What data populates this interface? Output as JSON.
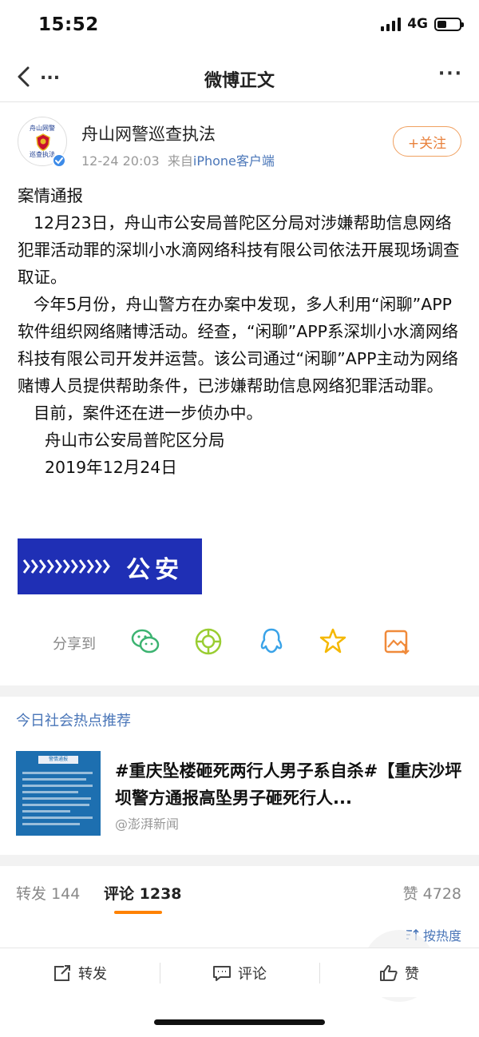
{
  "status_bar": {
    "time": "15:52",
    "network": "4G",
    "battery_level": 0.42
  },
  "nav": {
    "back_icon": "chevron-left-icon",
    "left_more": "...",
    "title": "微博正文",
    "right_more": "···"
  },
  "post": {
    "avatar": {
      "top_text": "舟山网警",
      "bottom_text": "巡查执法",
      "verified_color": "#3d8be8"
    },
    "author": "舟山网警巡查执法",
    "time": "12-24 20:03",
    "source_prefix": "来自",
    "source": "iPhone客户端",
    "follow_label": "+关注",
    "body": {
      "heading": "案情通报",
      "para1": "12月23日，舟山市公安局普陀区分局对涉嫌帮助信息网络犯罪活动罪的深圳小水滴网络科技有限公司依法开展现场调查取证。",
      "para2": "今年5月份，舟山警方在办案中发现，多人利用“闲聊”APP软件组织网络赌博活动。经查，“闲聊”APP系深圳小水滴网络科技有限公司开发并运营。该公司通过“闲聊”APP主动为网络赌博人员提供帮助条件，已涉嫌帮助信息网络犯罪活动罪。",
      "para3": "目前，案件还在进一步侦办中。",
      "signature_org": "舟山市公安局普陀区分局",
      "signature_date": "2019年12月24日"
    },
    "image_text": "公安",
    "image_color": "#1f2fb5"
  },
  "share": {
    "label": "分享到",
    "targets": [
      "wechat-icon",
      "moments-icon",
      "qq-icon",
      "qzone-icon",
      "save-image-icon"
    ]
  },
  "hot": {
    "section_title": "今日社会热点推荐",
    "headline": "#重庆坠楼砸死两行人男子系自杀#【重庆沙坪坝警方通报高坠男子砸死行人...",
    "source": "@澎湃新闻",
    "thumb_header": "警情通报"
  },
  "tabs": {
    "repost_label": "转发",
    "repost_count": "144",
    "comment_label": "评论",
    "comment_count": "1238",
    "like_label": "赞",
    "like_count": "4728",
    "accent": "#ff8200"
  },
  "sort": {
    "label": "按热度"
  },
  "bottom_bar": {
    "repost": "转发",
    "comment": "评论",
    "like": "赞"
  }
}
